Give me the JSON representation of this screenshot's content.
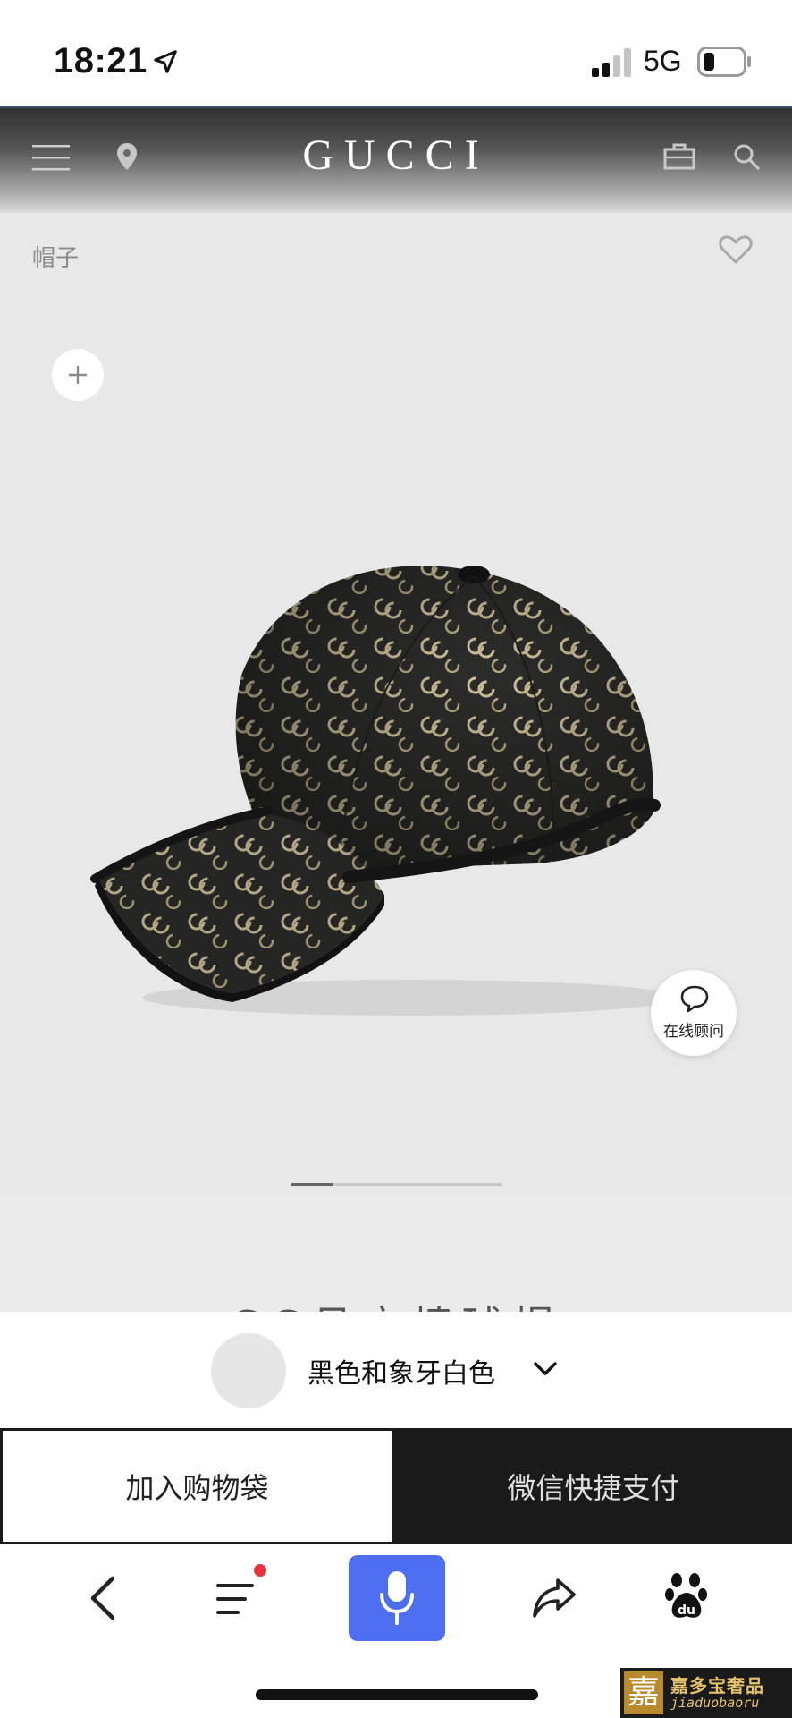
{
  "status_bar": {
    "time": "18:21",
    "network": "5G"
  },
  "header": {
    "brand": "GUCCI"
  },
  "product": {
    "category": "帽子",
    "title": "GG丹宁棒球帽",
    "image_progress": 0.2,
    "color": {
      "label": "黑色和象牙白色"
    }
  },
  "chat": {
    "label": "在线顾问"
  },
  "actions": {
    "add_to_bag": "加入购物袋",
    "wechat_pay": "微信快捷支付"
  },
  "watermark": {
    "characters": "嘉",
    "name": "嘉多宝奢品",
    "romanized": "jiaduobaoru"
  },
  "colors": {
    "accent_voice": "#4e6ef2",
    "notification_dot": "#e8323c",
    "pay_button": "#1a1a1a",
    "gallery_bg": "#e8e8e8"
  },
  "icons": [
    "location-arrow-icon",
    "signal-icon",
    "battery-icon",
    "menu-icon",
    "location-pin-icon",
    "shopping-bag-icon",
    "search-icon",
    "heart-icon",
    "plus-icon",
    "chat-bubble-icon",
    "chevron-down-icon",
    "back-icon",
    "list-icon",
    "microphone-icon",
    "share-icon",
    "baidu-paw-icon"
  ]
}
